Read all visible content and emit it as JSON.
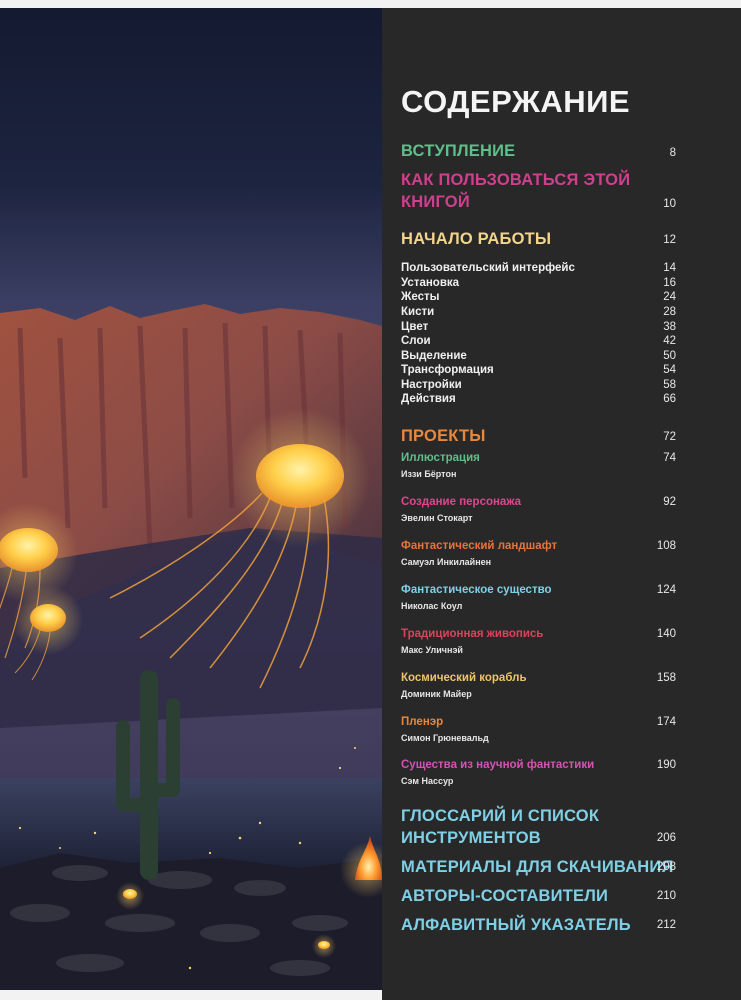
{
  "title": "СОДЕРЖАНИЕ",
  "colors": {
    "intro": "#5fbf8a",
    "how_to": "#d03f8e",
    "getting_started": "#f2d48a",
    "projects": "#e9873a",
    "glossary": "#7fd0e6"
  },
  "sections_top": [
    {
      "label": "ВСТУПЛЕНИЕ",
      "page": "8"
    },
    {
      "label_line1": "КАК ПОЛЬЗОВАТЬСЯ ЭТОЙ",
      "label_line2": "КНИГОЙ",
      "page": "10"
    },
    {
      "label": "НАЧАЛО РАБОТЫ",
      "page": "12"
    }
  ],
  "getting_started_items": [
    {
      "label": "Пользовательский интерфейс",
      "page": "14"
    },
    {
      "label": "Установка",
      "page": "16"
    },
    {
      "label": "Жесты",
      "page": "24"
    },
    {
      "label": "Кисти",
      "page": "28"
    },
    {
      "label": "Цвет",
      "page": "38"
    },
    {
      "label": "Слои",
      "page": "42"
    },
    {
      "label": "Выделение",
      "page": "50"
    },
    {
      "label": "Трансформация",
      "page": "54"
    },
    {
      "label": "Настройки",
      "page": "58"
    },
    {
      "label": "Действия",
      "page": "66"
    }
  ],
  "projects_heading": {
    "label": "ПРОЕКТЫ",
    "page": "72"
  },
  "projects": [
    {
      "title": "Иллюстрация",
      "author": "Иззи Бёртон",
      "page": "74",
      "color": "#5fbf8a"
    },
    {
      "title": "Создание персонажа",
      "author": "Эвелин Стокарт",
      "page": "92",
      "color": "#e0468f"
    },
    {
      "title": "Фантастический ландшафт",
      "author": "Самуэл Инкилайнен",
      "page": "108",
      "color": "#e9733a"
    },
    {
      "title": "Фантастическое существо",
      "author": "Николас Коул",
      "page": "124",
      "color": "#7fd0e6"
    },
    {
      "title": "Традиционная живопись",
      "author": "Макс Уличнэй",
      "page": "140",
      "color": "#d8455a"
    },
    {
      "title": "Космический корабль",
      "author": "Доминик Майер",
      "page": "158",
      "color": "#eec46a"
    },
    {
      "title": "Пленэр",
      "author": "Симон Грюневальд",
      "page": "174",
      "color": "#e9873a"
    },
    {
      "title": "Существа из научной фантастики",
      "author": "Сэм Нассур",
      "page": "190",
      "color": "#d553b5"
    }
  ],
  "sections_bottom": [
    {
      "label_line1": "ГЛОССАРИЙ И СПИСОК",
      "label_line2": "ИНСТРУМЕНТОВ",
      "page": "206"
    },
    {
      "label": "МАТЕРИАЛЫ ДЛЯ СКАЧИВАНИЯ",
      "page": "208"
    },
    {
      "label": "АВТОРЫ-СОСТАВИТЕЛИ",
      "page": "210"
    },
    {
      "label": "АЛФАВИТНЫЙ УКАЗАТЕЛЬ",
      "page": "212"
    }
  ]
}
